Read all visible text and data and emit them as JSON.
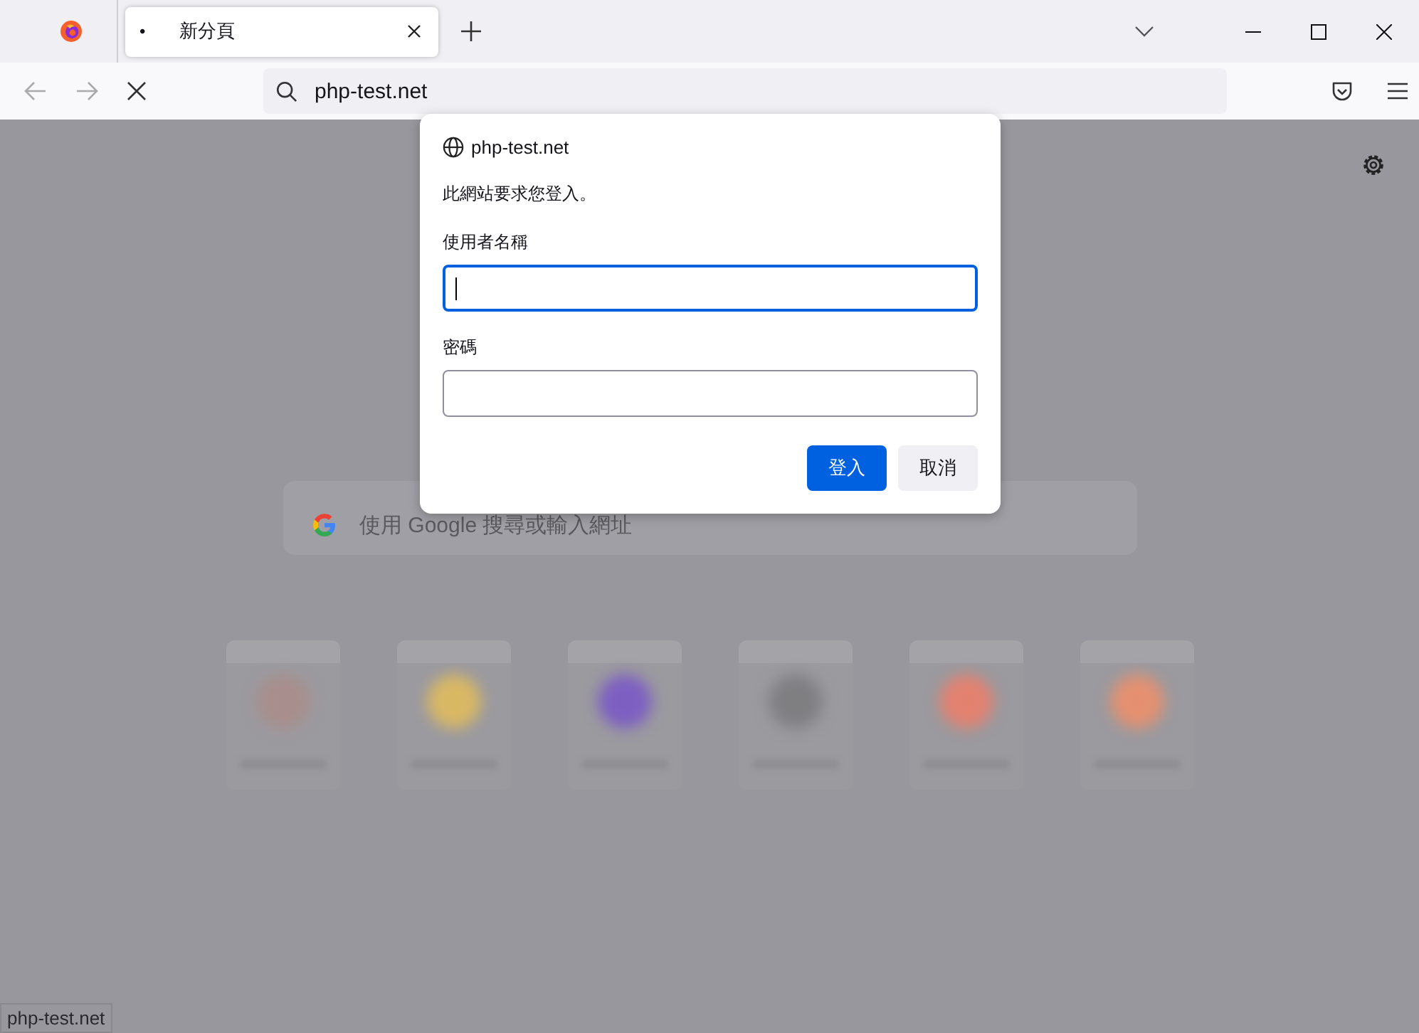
{
  "tabs": [
    {
      "indicator": "•",
      "title": "新分頁",
      "selected": true
    }
  ],
  "address_bar": {
    "value": "php-test.net"
  },
  "new_tab_page": {
    "search_placeholder": "使用 Google 搜尋或輸入網址",
    "shortcuts": [
      {
        "color": "#a88e8c"
      },
      {
        "color": "#d9b864"
      },
      {
        "color": "#7d5fc2"
      },
      {
        "color": "#7f7f82"
      },
      {
        "color": "#e3816f"
      },
      {
        "color": "#e49070"
      }
    ]
  },
  "auth_dialog": {
    "site": "php-test.net",
    "message": "此網站要求您登入。",
    "fields": [
      {
        "label": "使用者名稱",
        "focused": true
      },
      {
        "label": "密碼",
        "focused": false
      }
    ],
    "buttons": [
      {
        "label": "登入",
        "kind": "primary"
      },
      {
        "label": "取消",
        "kind": "secondary"
      }
    ]
  },
  "status_bar": {
    "text": "php-test.net"
  }
}
